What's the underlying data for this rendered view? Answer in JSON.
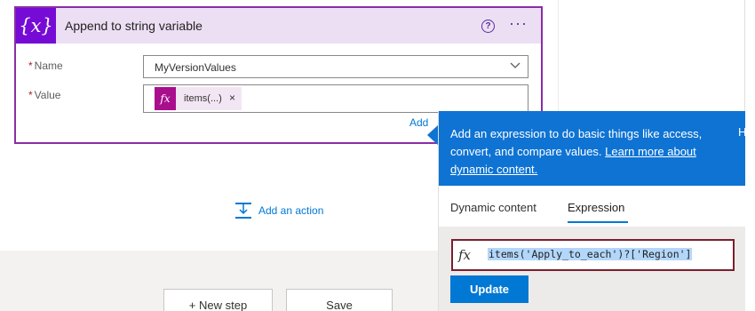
{
  "card": {
    "title": "Append to string variable",
    "icon_text": "{x}",
    "help_icon_text": "?",
    "more_icon_text": "···"
  },
  "fields": {
    "name": {
      "required_mark": "*",
      "label": "Name",
      "value": "MyVersionValues"
    },
    "value": {
      "required_mark": "*",
      "label": "Value",
      "token": {
        "icon_text": "fx",
        "label": "items(...)",
        "remove": "×"
      }
    }
  },
  "add_dynamic_content": "Add",
  "add_action": {
    "label": "Add an action"
  },
  "footer": {
    "new_step": "+ New step",
    "save": "Save"
  },
  "expression_panel": {
    "banner_text": "Add an expression to do basic things like access, convert, and compare values. ",
    "banner_link": "Learn more about dynamic content.",
    "banner_overflow": "H",
    "tabs": [
      {
        "label": "Dynamic content",
        "active": false
      },
      {
        "label": "Expression",
        "active": true
      }
    ],
    "fx_glyph": "fx",
    "expression": "items('Apply_to_each')?['Region']",
    "update_button": "Update"
  },
  "colors": {
    "card_border": "#8a2da5",
    "card_header_bg": "#ecdff4",
    "variable_icon_bg": "#770bd6",
    "token_icon_bg": "#a90e8d",
    "banner_bg": "#0f73d3",
    "accent_blue": "#0078d4",
    "editor_border": "#7a1f2e"
  }
}
